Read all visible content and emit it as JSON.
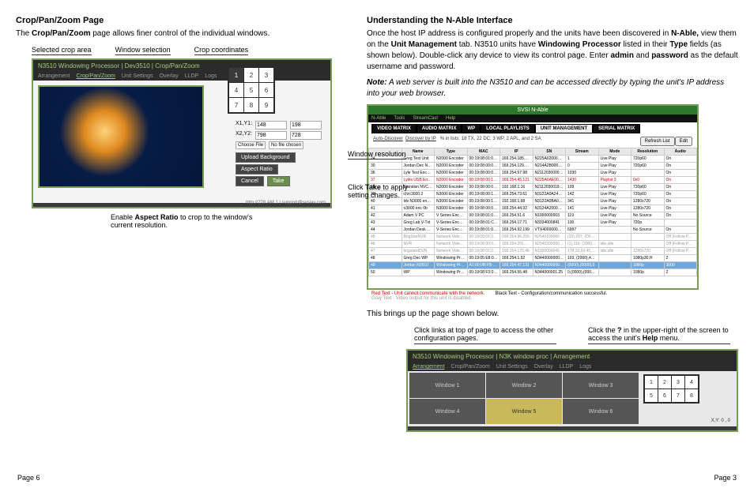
{
  "left": {
    "heading": "Crop/Pan/Zoom Page",
    "intro_pre": "The ",
    "intro_bold": "Crop/Pan/Zoom",
    "intro_post": " page allows finer control of the individual windows.",
    "callouts": {
      "selected_crop": "Selected crop area",
      "window_selection": "Window selection",
      "crop_coords": "Crop coordinates",
      "window_res": "Window resolution",
      "take_pre": "Click ",
      "take_b": "Take",
      "take_post": " to apply setting changes.",
      "aspect_pre": "Enable ",
      "aspect_b": "Aspect Ratio",
      "aspect_post": " to crop to the window's current resolution."
    },
    "shot": {
      "title": "N3510 Windowing Processor | Dev3510 | Crop/Pan/Zoom",
      "tabs": [
        "Arrangement",
        "Crop/Pan/Zoom",
        "Unit Settings",
        "Overlay",
        "LLDP",
        "Logs"
      ],
      "grid": [
        "1",
        "2",
        "3",
        "4",
        "5",
        "6",
        "7",
        "8",
        "9"
      ],
      "coords": {
        "x1y1": "X1,Y1:",
        "x1": "148",
        "y1": "198",
        "x2y2": "X2,Y2:",
        "x2": "798",
        "y2": "728"
      },
      "choose": "Choose File",
      "nofile": "No file chosen",
      "upload": "Upload Background",
      "aspect_btn": "Aspect Ratio",
      "cancel": "Cancel",
      "take": "Take",
      "footer": "http://278.AM.1 | support@svsiav.com"
    }
  },
  "right": {
    "heading": "Understanding the N-Able Interface",
    "p1_a": "Once the host IP address is configured properly and the units have been discovered in ",
    "p1_b": "N-Able,",
    "p1_c": " view them on the ",
    "p1_d": "Unit Management",
    "p1_e": " tab. N3510 units have ",
    "p1_f": "Windowing Processor",
    "p1_g": " listed in their ",
    "p1_h": "Type",
    "p1_i": " fields (as shown below). Double-click any device to view its control page. Enter ",
    "p1_j": "admin",
    "p1_k": " and ",
    "p1_l": "password",
    "p1_m": " as the default username and password.",
    "note_label": "Note:",
    "note_body": " A web server is built into the N3510 and can be accessed directly by typing the unit's IP address into your web browser.",
    "shot2": {
      "title": "SVSI N-Able",
      "menu": [
        "N-Able",
        "Tools",
        "StreamCast",
        "Help"
      ],
      "tabs": [
        "VIDEO MATRIX",
        "AUDIO MATRIX",
        "WP",
        "LOCAL PLAYLISTS",
        "UNIT MANAGEMENT",
        "SERIAL MATRIX"
      ],
      "sub_a": "Auto-Discover",
      "sub_b": "Discover by IP",
      "sub_c": "% in lists: 18 TX, 22 DC, 3 WP, 2 APL, and 2 SA",
      "btn1": "Refresh List",
      "btn2": "Edit",
      "cols": [
        "",
        "Name",
        "Type",
        "MAC",
        "IP",
        "SN",
        "Stream",
        "Mode",
        "Resolution",
        "Audio"
      ],
      "rows": [
        {
          "c": [
            "24",
            "Greg Test Unit",
            "N2000 Encoder",
            "00:19:08:01:09:01",
            "169.254.185.226",
            "N225A0200000011",
            "1",
            "Live Play",
            "720p60",
            "On"
          ]
        },
        {
          "c": [
            "30",
            "Jordan Dec N2000",
            "N2000 Encoder",
            "00:19:08:00:09:04",
            "169.254.129.124",
            "N214A2B0000001",
            "0",
            "Live Play",
            "720p60",
            "On"
          ]
        },
        {
          "c": [
            "36",
            "Lyle Test Encoder",
            "N2000 Encoder",
            "00:19:08:00:06:C3",
            "169.254.57.98",
            "N211203000003",
            "1030",
            "Live Play",
            "",
            "On"
          ]
        },
        {
          "c": [
            "37",
            "Lyles USB Enc 0",
            "N2000 Encoder",
            "00:19:08:00:1A:0A",
            "169.254.45.121",
            "N225A0AE001731",
            "1430",
            "Playlist 3",
            "0x0",
            "On"
          ],
          "cls": "red"
        },
        {
          "c": [
            "38",
            "Standisn NVC TX",
            "N2000 Encoder",
            "00:19:08:00:07:57",
            "192.168.1.16",
            "N211203001903",
            "199",
            "Live Play",
            "720p60",
            "On"
          ]
        },
        {
          "c": [
            "39",
            "chrc3000.2",
            "N3000 Encoder",
            "00:19:08:00:18:5C",
            "169.254.73.61",
            "N3122A0A24001092",
            "142",
            "Live Play",
            "720p60",
            "On"
          ]
        },
        {
          "c": [
            "40",
            "Idv N3000 enc 32",
            "N3000 Encoder",
            "00:19:08:00:12:32",
            "192.168.1.68",
            "N3122A0BA000090",
            "341",
            "Live Play",
            "1280x720",
            "On"
          ]
        },
        {
          "c": [
            "41",
            "n3000 enc 0b",
            "N3000 Encoder",
            "00:19:08:00:06:08",
            "169.254.44.92",
            "N3124A2000000015",
            "141",
            "Live Play",
            "1280x720",
            "On"
          ]
        },
        {
          "c": [
            "42",
            "Adam V PC",
            "V Series Encoder",
            "00:19:08:01:00:03",
            "169.254.51.6",
            "N1000000003",
            "119",
            "Live Play",
            "No Source",
            "On"
          ]
        },
        {
          "c": [
            "43",
            "Greg Lab V-Txt",
            "V-Series Encoder",
            "00:19:08:01:C5:1C",
            "169.254.17.71",
            "N3334000841",
            "100",
            "Live Play",
            "720p",
            ""
          ]
        },
        {
          "c": [
            "44",
            "Jordan Desk TX1",
            "V-Series Encoder",
            "00:19:08:01:08:4D",
            "169.254.92.199",
            "VTX4000000000109",
            "6997",
            "",
            "No Source",
            "On"
          ]
        },
        {
          "c": [
            "45",
            "BrigStarNVR",
            "Network Video Recorder",
            "00:19:08:01:06:04",
            "169.254.96.255",
            "N2540100065",
            "(20),207, (D030),043",
            "",
            "",
            "Off (Follow P..."
          ],
          "cls": "gray"
        },
        {
          "c": [
            "46",
            "NVR",
            "Network Video Recorder",
            "00:19:08:00:08:0E",
            "169.254.201.182",
            "N2540200000174",
            "(1),110, (3000),503",
            "idle,idle",
            "",
            "Off (Follow P..."
          ],
          "cls": "gray"
        },
        {
          "c": [
            "47",
            "brigstardDVR",
            "Network Video Recorder",
            "00:19:08:01:06:65",
            "169.254.170.46",
            "N1000000045",
            "178,33,60.45,mi...",
            "idle,idle",
            "1280x720",
            "Off (Follow P..."
          ],
          "cls": "gray"
        },
        {
          "c": [
            "48",
            "Greg Dec WP",
            "Windowing Processor",
            "00:19:05:E8:00:00",
            "169.254.1.52",
            "N344000000003",
            "103, (2000),40.45,mi...",
            "",
            "1080p30,H",
            "2"
          ]
        },
        {
          "c": [
            "49",
            "Jordan N3510",
            "Windowing Processor",
            "A1:00:0B:FB:9C:F7",
            "169.254.47.131",
            "N344000000007",
            "(0000),(0000),0",
            "",
            "1080p",
            "3000"
          ],
          "cls": "sel"
        },
        {
          "c": [
            "50",
            "WP",
            "Windowing Processor",
            "00:19:08:F3:00:10",
            "169.254.55.48",
            "N344000001.25",
            "0,(0000),(0000),0",
            "",
            "1080p",
            "2"
          ]
        }
      ],
      "legend_red": "Red Text - Unit cannot communicate with the network.",
      "legend_gray": "Gray Text - Video output for this unit is disabled.",
      "legend_black": "Black Text - Configuration/communication successful."
    },
    "brings": "This brings up the page shown below.",
    "cb_links": "Click links at top of page to access the other configuration pages.",
    "cb_help_a": "Click the ",
    "cb_help_b": "?",
    "cb_help_c": " in the upper-right of the screen to access the unit's ",
    "cb_help_d": "Help",
    "cb_help_e": " menu.",
    "shot3": {
      "title": "N3510 Windowing Processor | N3K window proc | Arrangement",
      "tabs": [
        "Arrangement",
        "Crop/Pan/Zoom",
        "Unit Settings",
        "Overlay",
        "LLDP",
        "Logs"
      ],
      "q": "?",
      "wins": [
        "Window 1",
        "Window 2",
        "Window 3",
        "Window 4",
        "Window 5",
        "Window 6"
      ],
      "grid": [
        "1",
        "2",
        "3",
        "4",
        "5",
        "6",
        "7",
        "8"
      ],
      "xy": "X,Y:  0  , 0"
    }
  },
  "footer": {
    "left": "Page 6",
    "right": "Page 3"
  }
}
